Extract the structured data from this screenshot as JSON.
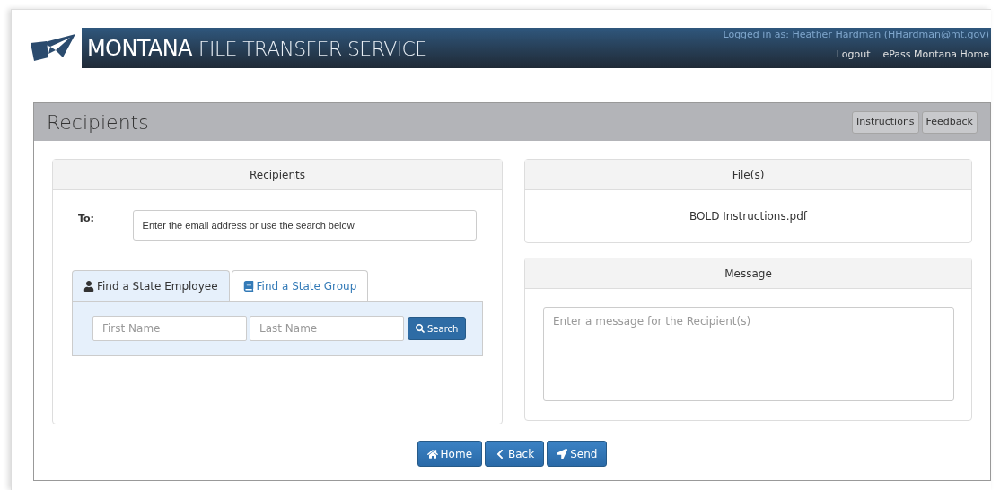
{
  "header": {
    "brand_bold": "MONTANA",
    "brand_rest": "FILE TRANSFER SERVICE",
    "logged_in": "Logged in as: Heather Hardman (HHardman@mt.gov)",
    "links": [
      "Logout",
      "ePass Montana Home"
    ]
  },
  "page": {
    "title": "Recipients",
    "buttons": [
      "Instructions",
      "Feedback"
    ]
  },
  "recipients": {
    "title": "Recipients",
    "to_label": "To:",
    "to_placeholder": "Enter the email address or use the search below",
    "tabs": [
      {
        "label": "Find a State Employee",
        "kind": "person",
        "selected": true
      },
      {
        "label": "Find a State Group",
        "kind": "group",
        "selected": false
      }
    ],
    "first_name_placeholder": "First Name",
    "last_name_placeholder": "Last Name",
    "search_button": "Search"
  },
  "files": {
    "title": "File(s)",
    "items": [
      "BOLD Instructions.pdf"
    ]
  },
  "message": {
    "title": "Message",
    "placeholder": "Enter a message for the Recipient(s)"
  },
  "actions": [
    {
      "label": "Home",
      "kind": "home"
    },
    {
      "label": "Back",
      "kind": "back"
    },
    {
      "label": "Send",
      "kind": "send"
    }
  ]
}
